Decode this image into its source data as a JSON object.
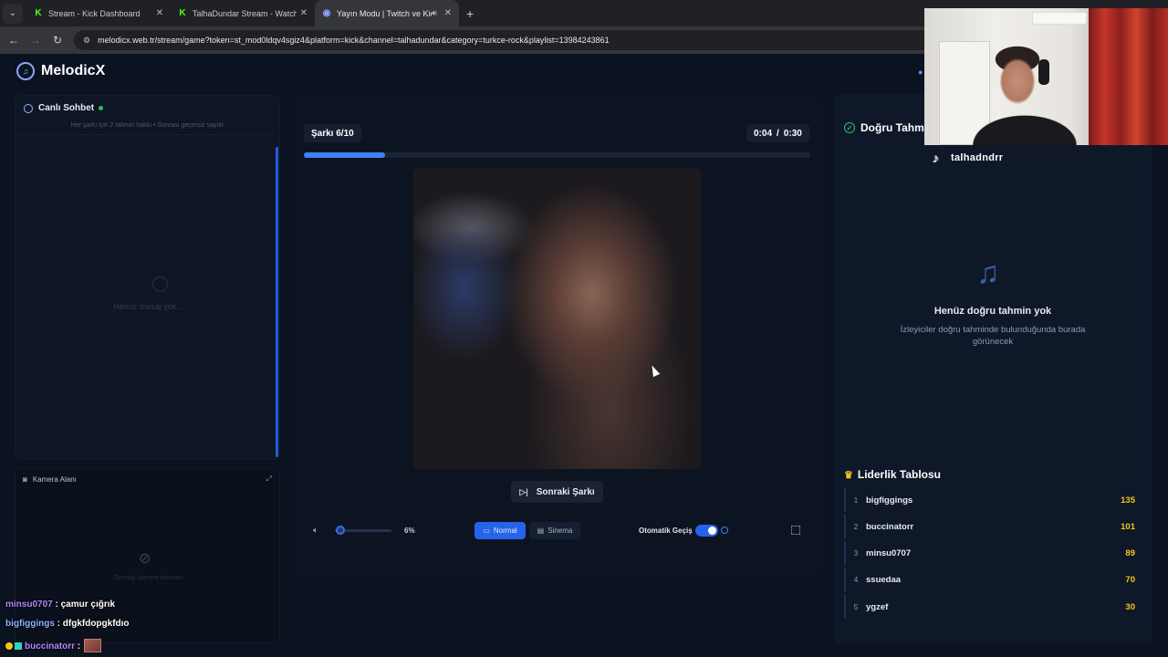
{
  "browser": {
    "tabs": [
      {
        "title": "Stream - Kick Dashboard",
        "favicon": "kick-icon",
        "active": false
      },
      {
        "title": "TalhaDundar Stream - Watch Li",
        "favicon": "kick-icon",
        "active": false
      },
      {
        "title": "Yayın Modu | Twitch ve Kick",
        "favicon": "melodicx-icon",
        "active": true
      }
    ],
    "url": "melodicx.web.tr/stream/game?token=st_mod0ldqv4sgiz4&platform=kick&channel=talhadundar&category=turkce-rock&playlist=13984243861"
  },
  "app": {
    "name": "MelodicX",
    "accent": "#3b82f6"
  },
  "chat": {
    "title": "Canlı Sohbet",
    "info": "Her şarkı için 2 tahmin hakkı • Sonrası geçersiz sayılır",
    "empty": "Henüz mesaj yok..."
  },
  "camera": {
    "title": "Kamera Alanı",
    "empty": "Overlay kamera konumu"
  },
  "stream_chat": [
    {
      "user": "minsu0707",
      "message": "çamur çığrık"
    },
    {
      "user": "bigfiggings",
      "message": "dfgkfdopgkfdıo"
    },
    {
      "user": "buccinatorr",
      "message": ""
    }
  ],
  "player": {
    "track_label": "Şarkı 6/10",
    "time_current": "0:04",
    "time_sep": "/",
    "time_total": "0:30",
    "progress": 0.16,
    "next_label": "Sonraki Şarkı",
    "volume_pct": "6%",
    "volume": 0.06,
    "mode_normal": "Normal",
    "mode_cinema": "Sinema",
    "auto_label": "Otomatik Geçiş",
    "auto_on": true
  },
  "guesses": {
    "title": "Doğru Tahm",
    "streamer": "talhadndrr",
    "empty_title": "Henüz doğru tahmin yok",
    "empty_sub": "İzleyiciler doğru tahminde bulunduğunda burada görünecek"
  },
  "leaderboard": {
    "title": "Liderlik Tablosu",
    "rows": [
      {
        "rank": "1",
        "name": "bigfiggings",
        "score": "135"
      },
      {
        "rank": "2",
        "name": "buccinatorr",
        "score": "101"
      },
      {
        "rank": "3",
        "name": "minsu0707",
        "score": "89"
      },
      {
        "rank": "4",
        "name": "ssuedaa",
        "score": "70"
      },
      {
        "rank": "5",
        "name": "ygzef",
        "score": "30"
      }
    ]
  }
}
